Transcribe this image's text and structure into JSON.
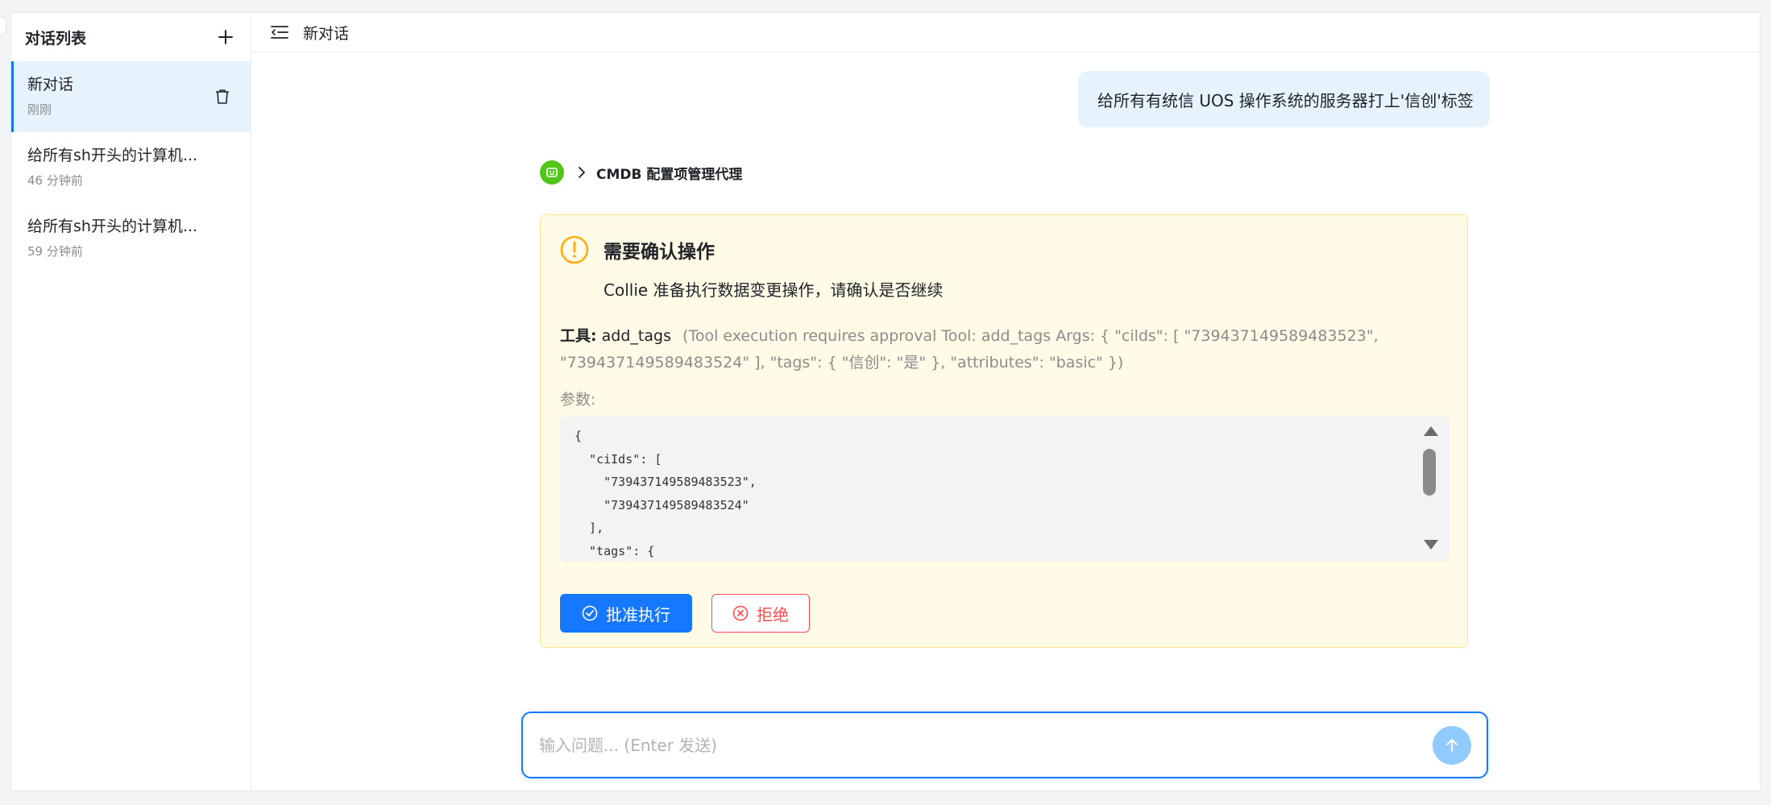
{
  "sidebar": {
    "title": "对话列表",
    "items": [
      {
        "title": "新对话",
        "time": "刚刚",
        "active": true
      },
      {
        "title": "给所有sh开头的计算机...",
        "time": "46 分钟前"
      },
      {
        "title": "给所有sh开头的计算机...",
        "time": "59 分钟前"
      }
    ]
  },
  "header": {
    "title": "新对话"
  },
  "chat": {
    "user_message": "给所有有统信 UOS 操作系统的服务器打上'信创'标签",
    "agent_name": "CMDB 配置项管理代理"
  },
  "confirm": {
    "title": "需要确认操作",
    "subtitle": "Collie 准备执行数据变更操作，请确认是否继续",
    "tool_label": "工具:",
    "tool_name": "add_tags",
    "tool_description": "(Tool execution requires approval Tool: add_tags Args: { \"cilds\": [ \"739437149589483523\", \"739437149589483524\" ], \"tags\": { \"信创\": \"是\" }, \"attributes\": \"basic\" })",
    "params_label": "参数:",
    "params_json": "{\n  \"ciIds\": [\n    \"739437149589483523\",\n    \"739437149589483524\"\n  ],\n  \"tags\": {",
    "approve_label": "批准执行",
    "reject_label": "拒绝"
  },
  "input": {
    "placeholder": "输入问题... (Enter 发送)",
    "value": ""
  },
  "colors": {
    "accent": "#1677ff",
    "active_bg": "#e6f3fd",
    "warning_bg": "#fffbe6",
    "warning_border": "#ffe58f",
    "danger": "#ff4d4f",
    "agent_green": "#52c41a"
  }
}
